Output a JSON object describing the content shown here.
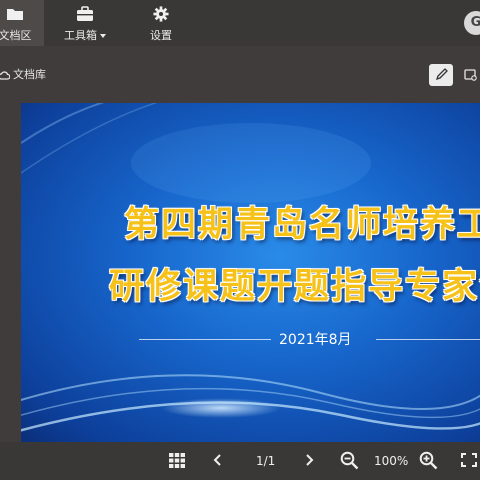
{
  "nav": {
    "docs_label": "文档区",
    "tools_label": "工具箱",
    "settings_label": "设置",
    "avatar_initial": "G"
  },
  "breadcrumb": {
    "label": "文档库"
  },
  "slide": {
    "title_line1": "第四期青岛名师培养工",
    "title_line2": "研修课题开题指导专家会",
    "date": "2021年8月"
  },
  "viewer": {
    "page_indicator": "1/1",
    "zoom": "100%"
  },
  "colors": {
    "topbar": "#3a3837",
    "background": "#3f3c3b",
    "slide_blue": "#1766cc",
    "title_gold": "#f6c21a"
  },
  "icons": [
    "folder-icon",
    "toolbox-icon",
    "gear-icon",
    "cloud-icon",
    "pencil-icon",
    "comment-icon",
    "grid-icon",
    "prev-icon",
    "next-icon",
    "zoom-out-icon",
    "zoom-in-icon",
    "fullscreen-icon"
  ]
}
